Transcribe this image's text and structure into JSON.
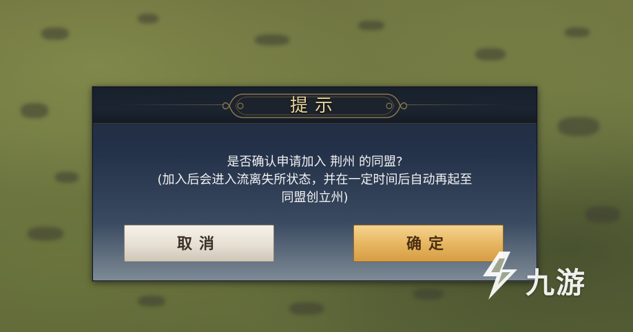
{
  "dialog": {
    "title": "提示",
    "message_line1": "是否确认申请加入 荆州 的同盟?",
    "message_line2": "(加入后会进入流离失所状态，并在一定时间后自动再起至",
    "message_line3": "同盟创立州)",
    "cancel_label": "取消",
    "confirm_label": "确定"
  },
  "watermark": {
    "text": "九游",
    "icon": "jiuyou-logo-icon"
  },
  "colors": {
    "title_gold": "#e9d29a",
    "confirm_button": "#e7b762",
    "cancel_button": "#e6dfd2",
    "dialog_bg": "#24324a"
  }
}
